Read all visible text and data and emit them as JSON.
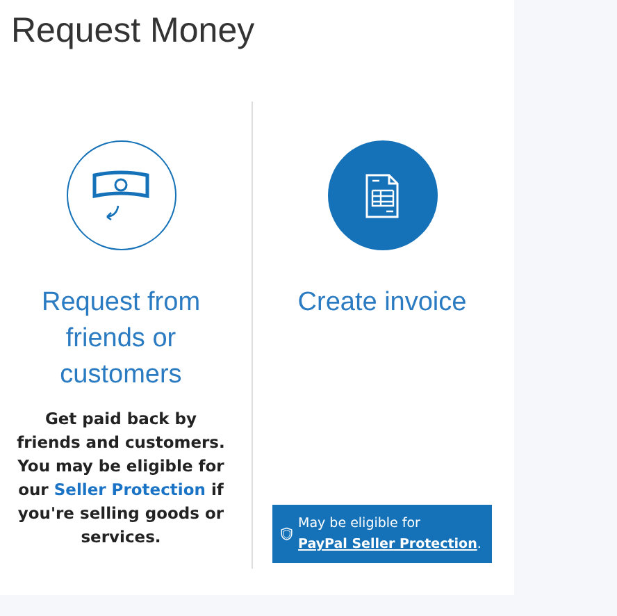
{
  "title": "Request Money",
  "options": [
    {
      "kind": "outline",
      "title": "Request from friends or customers",
      "description": {
        "before": "Get paid back by friends and customers. You may be eligible for our ",
        "link": "Seller Protection",
        "after": " if you're selling goods or services."
      }
    },
    {
      "kind": "filled",
      "title": "Create invoice",
      "badge": {
        "before": "May be eligible for ",
        "link": "PayPal Seller Protection",
        "after": "."
      }
    }
  ]
}
